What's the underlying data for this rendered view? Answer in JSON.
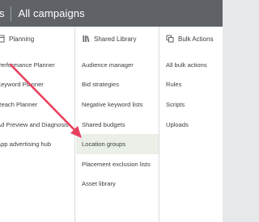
{
  "topbar": {
    "previous_crumb": "s",
    "current_crumb": "All campaigns"
  },
  "columns": {
    "planning": {
      "title": "Planning",
      "icon": "planning-icon",
      "items": [
        {
          "label": "Performance Planner"
        },
        {
          "label": "Keyword Planner"
        },
        {
          "label": "Reach Planner"
        },
        {
          "label": "Ad Preview and Diagnosis"
        },
        {
          "label": "App advertising hub"
        }
      ]
    },
    "shared_library": {
      "title": "Shared Library",
      "icon": "shared-library-icon",
      "items": [
        {
          "label": "Audience manager"
        },
        {
          "label": "Bid strategies"
        },
        {
          "label": "Negative keyword lists"
        },
        {
          "label": "Shared budgets"
        },
        {
          "label": "Location groups",
          "highlighted": true
        },
        {
          "label": "Placement exclusion lists"
        },
        {
          "label": "Asset library"
        }
      ]
    },
    "bulk_actions": {
      "title": "Bulk Actions",
      "icon": "bulk-actions-icon",
      "items": [
        {
          "label": "All bulk actions"
        },
        {
          "label": "Rules"
        },
        {
          "label": "Scripts"
        },
        {
          "label": "Uploads"
        }
      ]
    }
  },
  "colors": {
    "topbar": "#5f6368",
    "panel": "#ffffff",
    "highlight": "#eaf0e7",
    "arrow": "#e8415f",
    "text": "#3c4043"
  }
}
